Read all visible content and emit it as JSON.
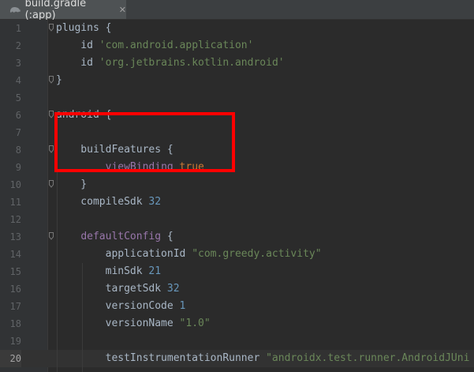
{
  "tab": {
    "title": "build.gradle (:app)",
    "close_glyph": "✕",
    "icon": "gradle-icon"
  },
  "current_line": 20,
  "lines": [
    {
      "n": "1",
      "tokens": [
        {
          "t": "plugins",
          "c": "plain"
        },
        {
          "t": " {",
          "c": "plain"
        }
      ]
    },
    {
      "n": "2",
      "tokens": [
        {
          "t": "    id ",
          "c": "plain"
        },
        {
          "t": "'com.android.application'",
          "c": "str"
        }
      ]
    },
    {
      "n": "3",
      "tokens": [
        {
          "t": "    id ",
          "c": "plain"
        },
        {
          "t": "'org.jetbrains.kotlin.android'",
          "c": "str"
        }
      ]
    },
    {
      "n": "4",
      "tokens": [
        {
          "t": "}",
          "c": "plain"
        }
      ]
    },
    {
      "n": "5",
      "tokens": []
    },
    {
      "n": "6",
      "tokens": [
        {
          "t": "android {",
          "c": "plain"
        }
      ]
    },
    {
      "n": "7",
      "tokens": []
    },
    {
      "n": "8",
      "tokens": [
        {
          "t": "    buildFeatures {",
          "c": "plain"
        }
      ]
    },
    {
      "n": "9",
      "tokens": [
        {
          "t": "        ",
          "c": "plain"
        },
        {
          "t": "viewBinding",
          "c": "prop"
        },
        {
          "t": " ",
          "c": "plain"
        },
        {
          "t": "true",
          "c": "kw"
        }
      ]
    },
    {
      "n": "10",
      "tokens": [
        {
          "t": "    }",
          "c": "plain"
        }
      ]
    },
    {
      "n": "11",
      "tokens": [
        {
          "t": "    compileSdk ",
          "c": "plain"
        },
        {
          "t": "32",
          "c": "num"
        }
      ]
    },
    {
      "n": "12",
      "tokens": []
    },
    {
      "n": "13",
      "tokens": [
        {
          "t": "    ",
          "c": "plain"
        },
        {
          "t": "defaultConfig",
          "c": "prop"
        },
        {
          "t": " {",
          "c": "plain"
        }
      ]
    },
    {
      "n": "14",
      "tokens": [
        {
          "t": "        applicationId ",
          "c": "plain"
        },
        {
          "t": "\"com.greedy.activity\"",
          "c": "str"
        }
      ]
    },
    {
      "n": "15",
      "tokens": [
        {
          "t": "        minSdk ",
          "c": "plain"
        },
        {
          "t": "21",
          "c": "num"
        }
      ]
    },
    {
      "n": "16",
      "tokens": [
        {
          "t": "        targetSdk ",
          "c": "plain"
        },
        {
          "t": "32",
          "c": "num"
        }
      ]
    },
    {
      "n": "17",
      "tokens": [
        {
          "t": "        versionCode ",
          "c": "plain"
        },
        {
          "t": "1",
          "c": "num"
        }
      ]
    },
    {
      "n": "18",
      "tokens": [
        {
          "t": "        versionName ",
          "c": "plain"
        },
        {
          "t": "\"1.0\"",
          "c": "str"
        }
      ]
    },
    {
      "n": "19",
      "tokens": []
    },
    {
      "n": "20",
      "tokens": [
        {
          "t": "        testInstrumentationRunner ",
          "c": "plain"
        },
        {
          "t": "\"androidx.test.runner.AndroidJUni",
          "c": "str"
        }
      ]
    }
  ],
  "fold_markers": [
    1,
    4,
    6,
    8,
    10,
    13
  ],
  "annotation": {
    "type": "highlight-box",
    "color": "#ff0000",
    "covers_lines": [
      8,
      10
    ]
  }
}
